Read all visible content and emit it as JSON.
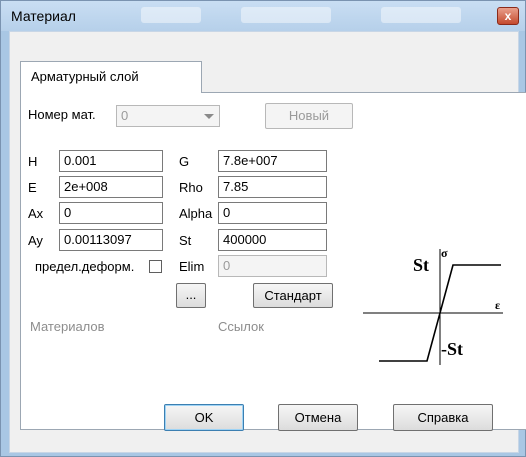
{
  "window": {
    "title": "Материал",
    "close_label": "x"
  },
  "tabs": [
    {
      "label": "Арматурный слой"
    }
  ],
  "material": {
    "number_label": "Номер мат.",
    "number_value": "0",
    "new_button": "Новый"
  },
  "fields": {
    "H": {
      "label": "H",
      "value": "0.001"
    },
    "G": {
      "label": "G",
      "value": "7.8e+007"
    },
    "E": {
      "label": "E",
      "value": "2e+008"
    },
    "Rho": {
      "label": "Rho",
      "value": "7.85"
    },
    "Ax": {
      "label": "Ax",
      "value": "0"
    },
    "Alpha": {
      "label": "Alpha",
      "value": "0"
    },
    "Ay": {
      "label": "Ay",
      "value": "0.00113097"
    },
    "St": {
      "label": "St",
      "value": "400000"
    },
    "Elim": {
      "label": "Elim",
      "value": "0"
    }
  },
  "limit_deform": {
    "label": "предел.деформ.",
    "checked": false
  },
  "buttons": {
    "dots": "...",
    "standard": "Стандарт",
    "ok": "OK",
    "cancel": "Отмена",
    "help": "Справка"
  },
  "status": {
    "materials": "Материалов",
    "links": "Ссылок"
  },
  "diagram": {
    "st_top": "St",
    "st_bottom": "-St",
    "sigma": "σ",
    "epsilon": "ε"
  }
}
